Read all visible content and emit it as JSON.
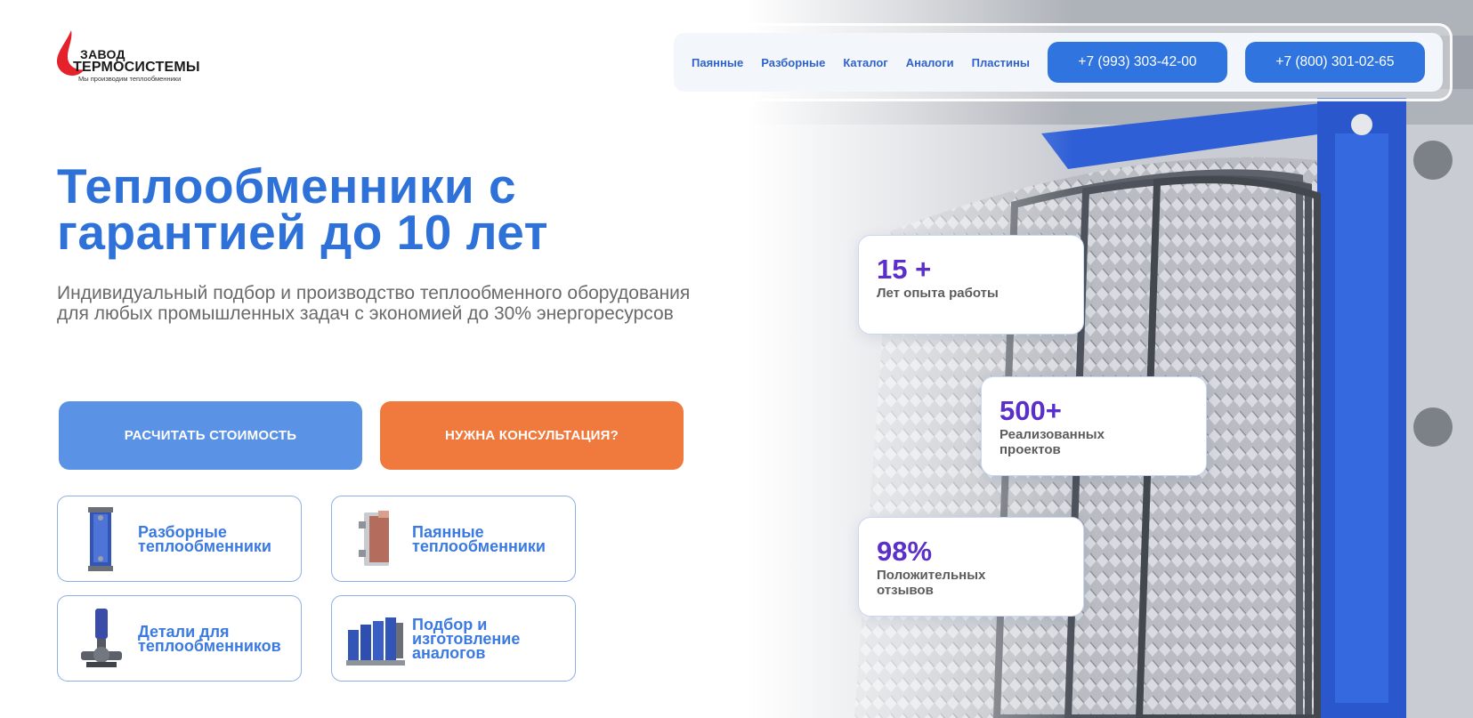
{
  "logo": {
    "line1": "ЗАВОД",
    "line2": "ТЕРМОСИСТЕМЫ",
    "tagline": "Мы производим теплообменники",
    "brand_color": "#e3222b"
  },
  "nav": {
    "links": [
      "Паянные",
      "Разборные",
      "Каталог",
      "Аналоги",
      "Пластины"
    ],
    "phones": [
      "+7 (993) 303-42-00",
      "+7 (800) 301-02-65"
    ],
    "accent": "#2f74df"
  },
  "hero": {
    "title": "Теплообменники с гарантией до 10 лет",
    "subtitle": "Индивидуальный подбор и производство теплообменного оборудования для любых промышленных задач с экономией до 30% энергоресурсов"
  },
  "cta": {
    "calculate": "РАСЧИТАТЬ СТОИМОСТЬ",
    "consult": "НУЖНА КОНСУЛЬТАЦИЯ?"
  },
  "products": [
    {
      "label": "Разборные\nтеплообменники",
      "icon": "plate-heat-exchanger-icon"
    },
    {
      "label": "Паянные\nтеплообменники",
      "icon": "brazed-heat-exchanger-icon"
    },
    {
      "label": "Детали для\nтеплообменников",
      "icon": "pump-icon"
    },
    {
      "label": "Подбор и\nизготовление\nаналогов",
      "icon": "exchanger-group-icon"
    }
  ],
  "stats": [
    {
      "value": "15 +",
      "label": "Лет опыта работы"
    },
    {
      "value": "500+",
      "label": "Реализованных\nпроектов"
    },
    {
      "value": "98%",
      "label": "Положительных\nотзывов"
    }
  ]
}
